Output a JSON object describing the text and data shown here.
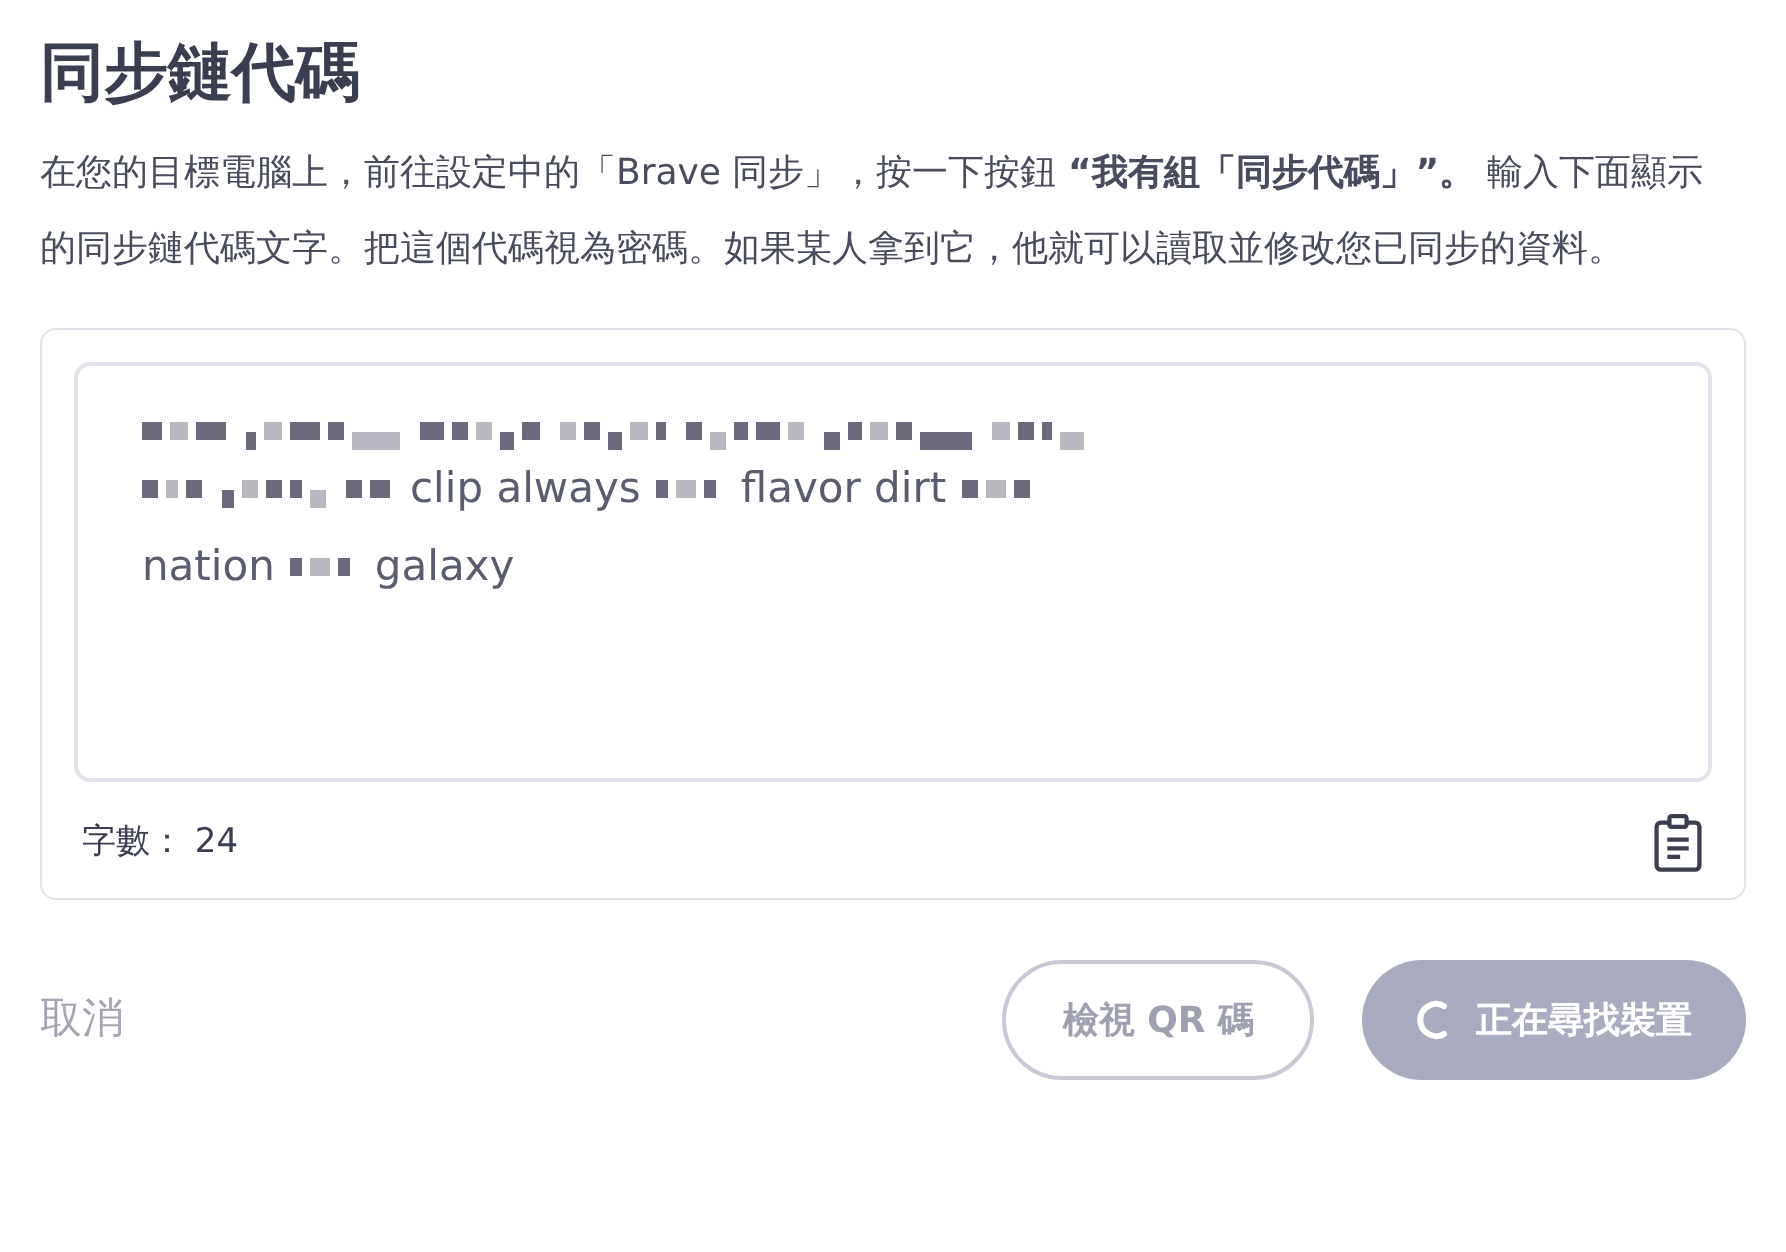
{
  "title": "同步鏈代碼",
  "description": "在您的目標電腦上，前往設定中的「Brave 同步」，按一下按鈕 **“我有組「同步代碼」”。** 輸入下面顯示的同步鏈代碼文字。把這個代碼視為密碼。如果某人拿到它，他就可以讀取並修改您已同步的資料。",
  "code_lines": [
    [
      {
        "kind": "redacted"
      }
    ],
    [
      {
        "kind": "redacted"
      },
      {
        "kind": "word",
        "text": "clip always"
      },
      {
        "kind": "redacted"
      },
      {
        "kind": "word",
        "text": "flavor dirt"
      },
      {
        "kind": "redacted"
      }
    ],
    [
      {
        "kind": "word",
        "text": "nation"
      },
      {
        "kind": "redacted"
      },
      {
        "kind": "word",
        "text": "galaxy"
      }
    ]
  ],
  "word_count": {
    "label": "字數：",
    "value": "24"
  },
  "buttons": [
    {
      "kind": "link",
      "label": "取消",
      "disabled": true
    },
    {
      "kind": "outline",
      "label": "檢視 QR 碼",
      "disabled": true
    },
    {
      "kind": "busy",
      "label": "正在尋找裝置",
      "disabled": true
    }
  ]
}
